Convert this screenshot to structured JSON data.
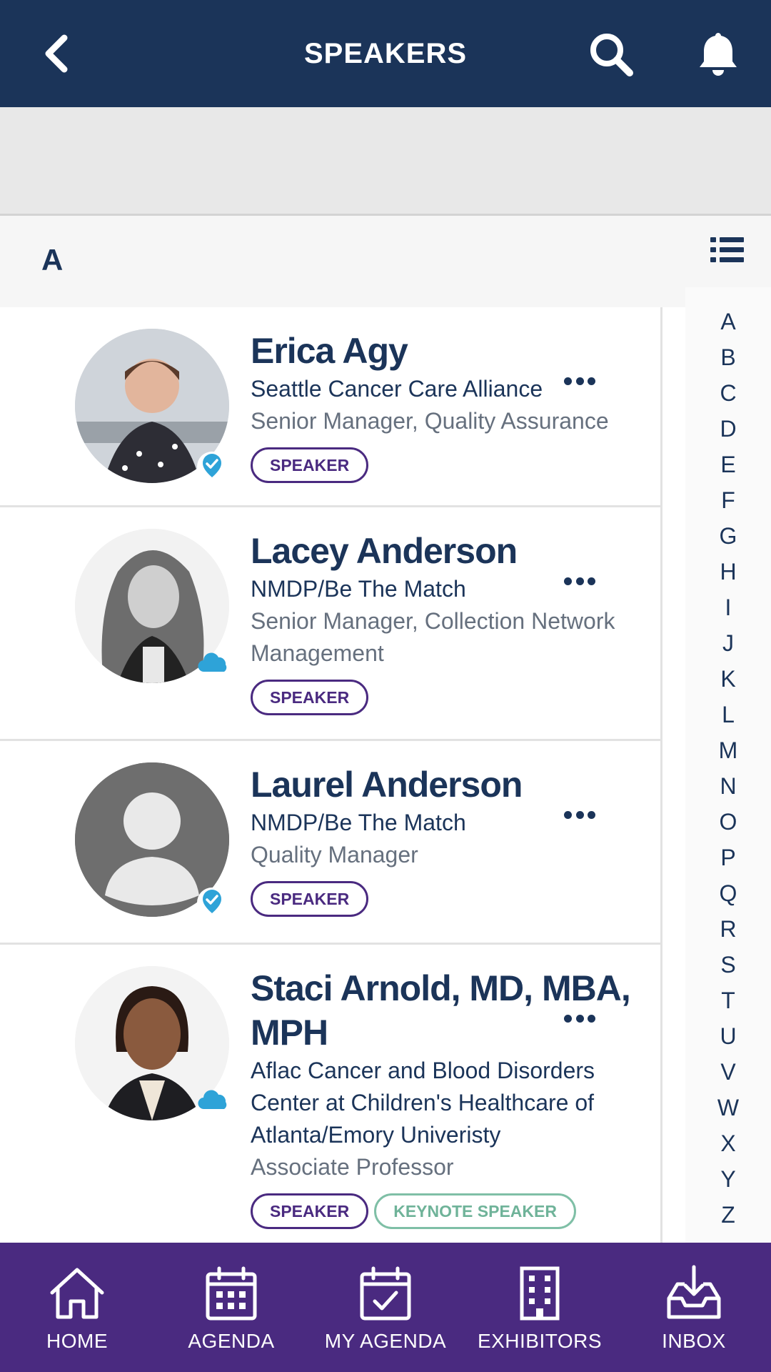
{
  "header": {
    "title": "SPEAKERS",
    "back_icon": "chevron-left-icon",
    "search_icon": "search-icon",
    "notifications_icon": "bell-icon"
  },
  "section": {
    "letter": "A",
    "view_toggle_icon": "list-view-icon"
  },
  "speakers": [
    {
      "name": "Erica Agy",
      "org": "Seattle Cancer Care Alliance",
      "role": "Senior Manager, Quality Assurance",
      "tags": [
        "SPEAKER"
      ],
      "badge": "verified-icon"
    },
    {
      "name": "Lacey Anderson",
      "org": "NMDP/Be The Match",
      "role": "Senior Manager, Collection Network Management",
      "tags": [
        "SPEAKER"
      ],
      "badge": "cloud-icon"
    },
    {
      "name": "Laurel Anderson",
      "org": "NMDP/Be The Match",
      "role": "Quality Manager",
      "tags": [
        "SPEAKER"
      ],
      "badge": "verified-icon"
    },
    {
      "name": "Staci Arnold, MD, MBA, MPH",
      "org": "Aflac Cancer and Blood Disorders Center at Children's Healthcare of Atlanta/Emory Univeristy",
      "role": "Associate Professor",
      "tags": [
        "SPEAKER",
        "KEYNOTE SPEAKER"
      ],
      "badge": "cloud-icon"
    }
  ],
  "alphabet": [
    "A",
    "B",
    "C",
    "D",
    "E",
    "F",
    "G",
    "H",
    "I",
    "J",
    "K",
    "L",
    "M",
    "N",
    "O",
    "P",
    "Q",
    "R",
    "S",
    "T",
    "U",
    "V",
    "W",
    "X",
    "Y",
    "Z"
  ],
  "tabs": [
    {
      "label": "HOME",
      "icon": "home-icon"
    },
    {
      "label": "AGENDA",
      "icon": "calendar-icon"
    },
    {
      "label": "MY AGENDA",
      "icon": "calendar-check-icon"
    },
    {
      "label": "EXHIBITORS",
      "icon": "building-icon"
    },
    {
      "label": "INBOX",
      "icon": "inbox-icon"
    }
  ],
  "colors": {
    "header": "#1b3459",
    "tabbar": "#4a2a80",
    "badge": "#2ea3d8",
    "speaker_tag": "#4a2a80",
    "keynote_tag": "#6fb399"
  }
}
